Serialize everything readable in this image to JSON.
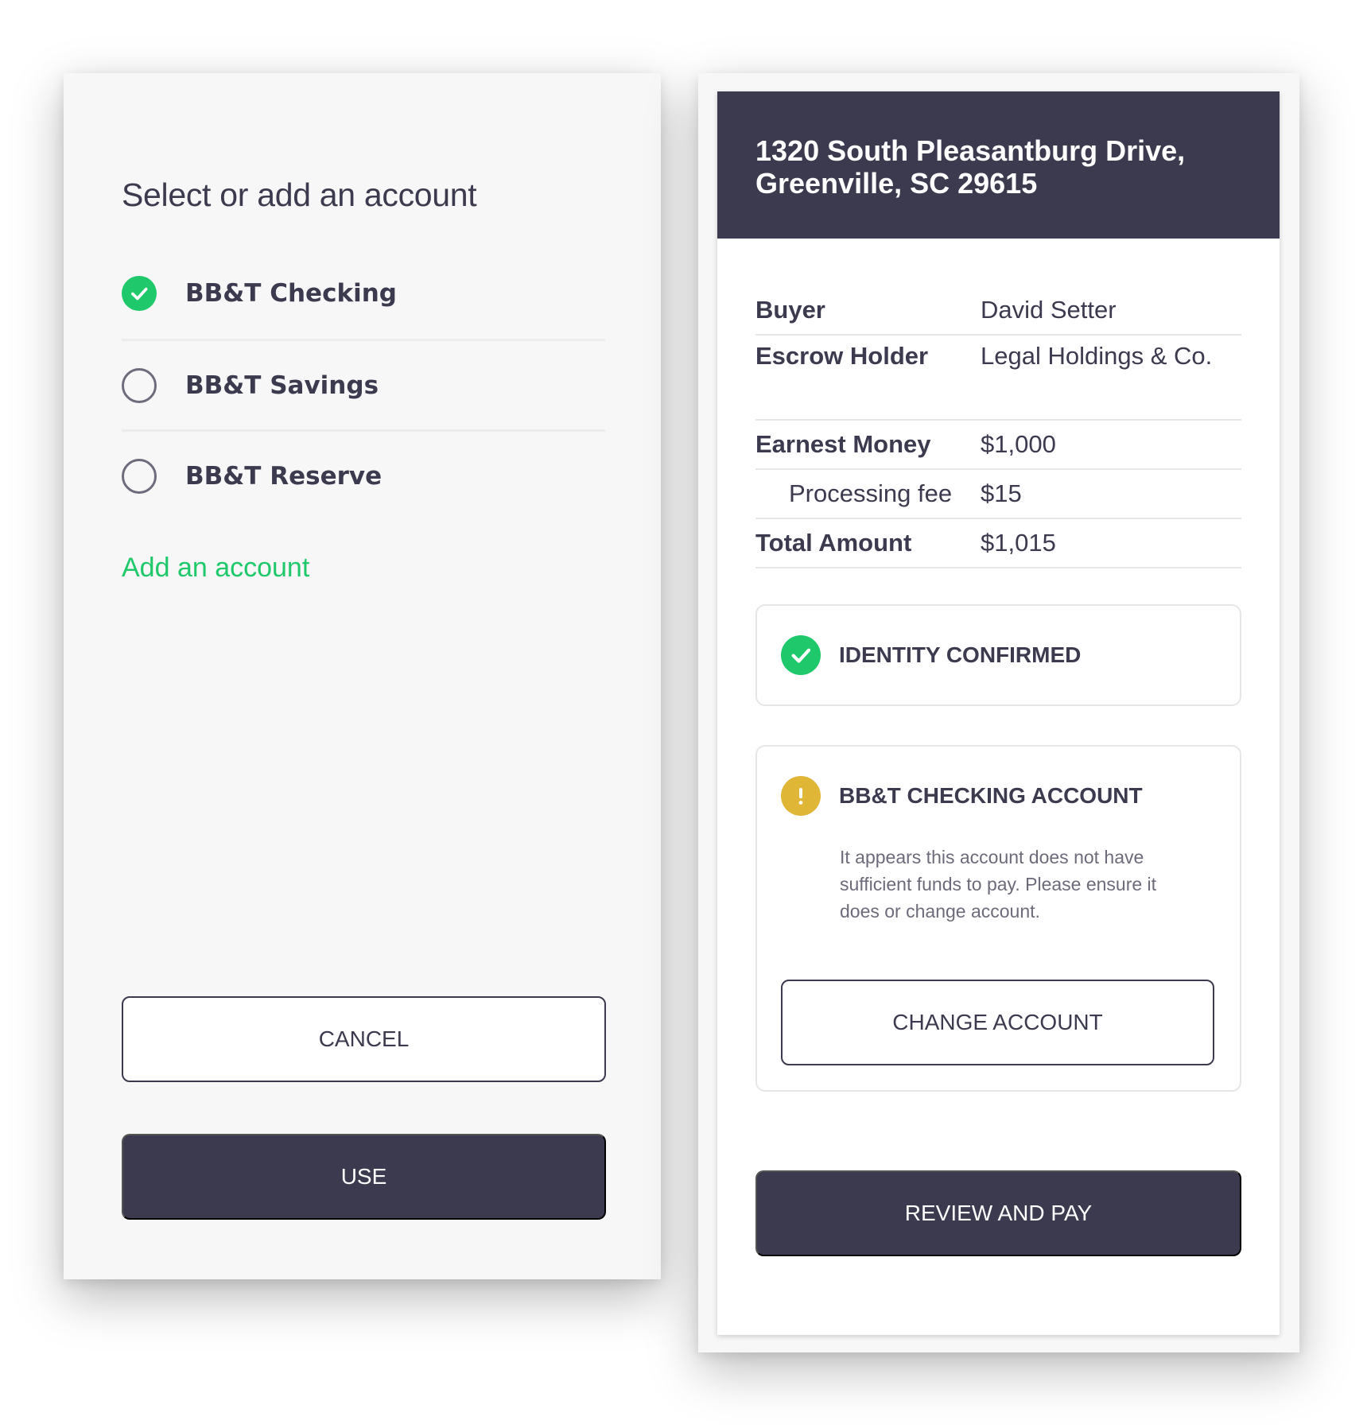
{
  "select_panel": {
    "title": "Select or add an account",
    "accounts": [
      {
        "label": "BB&T Checking",
        "selected": true
      },
      {
        "label": "BB&T Savings",
        "selected": false
      },
      {
        "label": "BB&T Reserve",
        "selected": false
      }
    ],
    "add_account_label": "Add an account",
    "cancel_label": "CANCEL",
    "use_label": "USE"
  },
  "payment_panel": {
    "address_line1": "1320 South Pleasantburg Drive,",
    "address_line2": "Greenville, SC 29615",
    "details": {
      "buyer_label": "Buyer",
      "buyer_value": "David Setter",
      "escrow_label": "Escrow Holder",
      "escrow_value": "Legal Holdings & Co.",
      "earnest_label": "Earnest Money",
      "earnest_value": "$1,000",
      "fee_label": "Processing fee",
      "fee_value": "$15",
      "total_label": "Total Amount",
      "total_value": "$1,015"
    },
    "identity_status": "IDENTITY CONFIRMED",
    "account_warning": {
      "title": "BB&T CHECKING ACCOUNT",
      "message": "It appears this account does not have sufficient funds to pay. Please ensure it does or change account.",
      "change_label": "CHANGE ACCOUNT"
    },
    "review_pay_label": "REVIEW AND PAY"
  },
  "colors": {
    "primary_dark": "#3b3a4e",
    "success_green": "#1fc86a",
    "warning_yellow": "#e0b636",
    "panel_bg": "#f7f7f7"
  },
  "icons": {
    "selected_radio": "check-circle-icon",
    "unselected_radio": "empty-circle-icon",
    "identity_status": "check-circle-icon",
    "account_warning": "exclamation-circle-icon"
  }
}
